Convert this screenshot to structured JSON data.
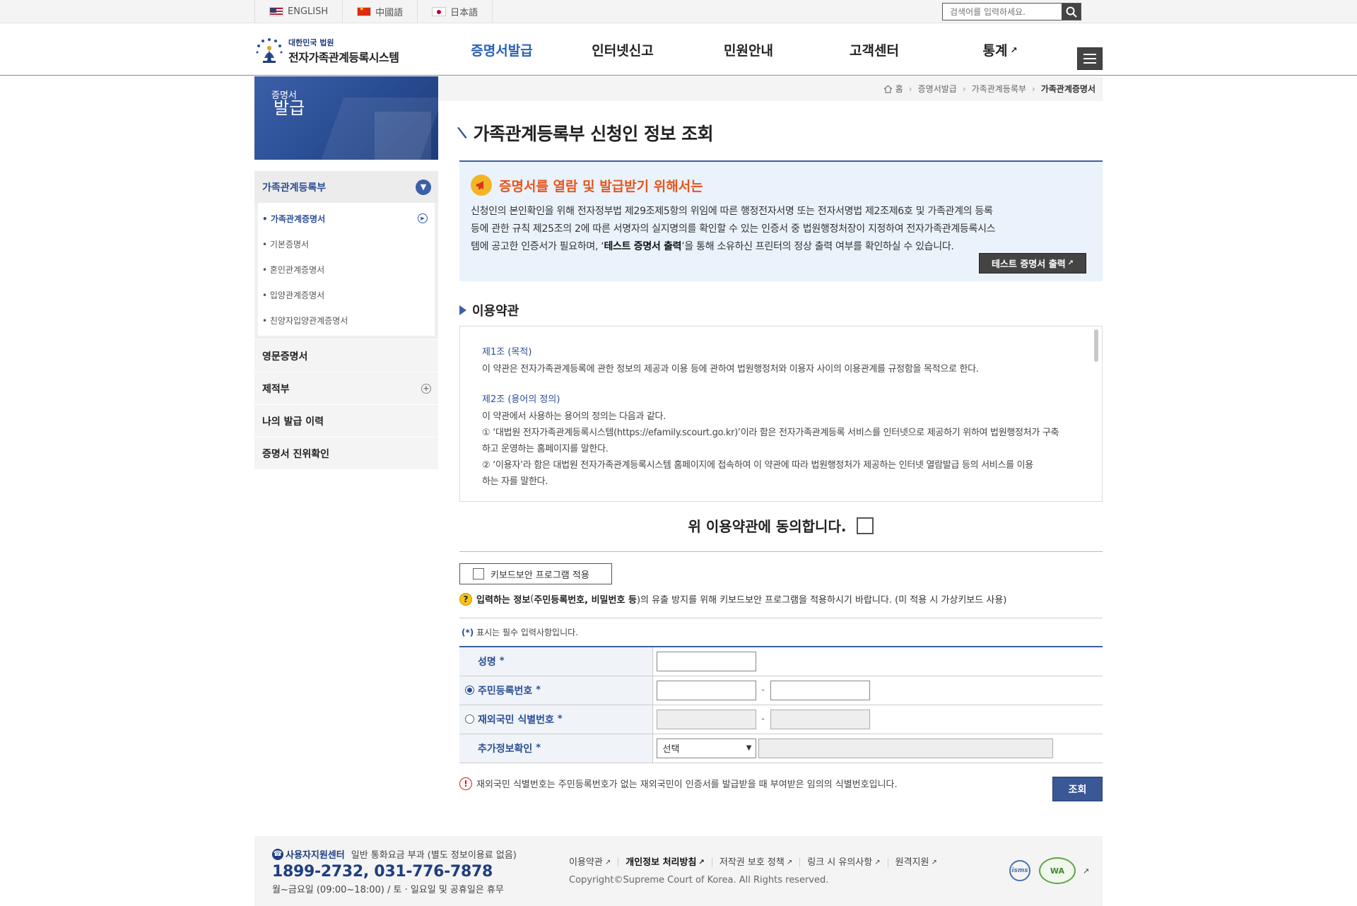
{
  "languages": [
    {
      "label": "ENGLISH",
      "flag": "us-flag-icon"
    },
    {
      "label": "中國語",
      "flag": "china-flag-icon"
    },
    {
      "label": "日本語",
      "flag": "japan-flag-icon"
    }
  ],
  "search": {
    "placeholder": "검색어를 입력하세요."
  },
  "logo": {
    "small": "대한민국 법원",
    "big": "전자가족관계등록시스템"
  },
  "gnb": [
    {
      "label": "증명서발급",
      "active": true
    },
    {
      "label": "인터넷신고"
    },
    {
      "label": "민원안내"
    },
    {
      "label": "고객센터"
    },
    {
      "label": "통계",
      "external": true
    }
  ],
  "sidebar": {
    "banner_small": "증명서",
    "banner_big": "발급",
    "section": "가족관계등록부",
    "sub_items": [
      {
        "label": "• 가족관계증명서",
        "active": true
      },
      {
        "label": "• 기본증명서"
      },
      {
        "label": "• 혼인관계증명서"
      },
      {
        "label": "• 입양관계증명서"
      },
      {
        "label": "• 친양자입양관계증명서"
      }
    ],
    "rows": [
      {
        "label": "영문증명서"
      },
      {
        "label": "제적부",
        "expand": true
      },
      {
        "label": "나의 발급 이력"
      },
      {
        "label": "증명서 진위확인"
      }
    ]
  },
  "breadcrumb": [
    "홈",
    "증명서발급",
    "가족관계등록부",
    "가족관계증명서"
  ],
  "page_title": "가족관계등록부 신청인 정보 조회",
  "notice": {
    "title": "증명서를 열람 및 발급받기 위해서는",
    "body_1": "신청인의 본인확인을 위해 전자정부법 제29조제5항의 위임에 따른 행정전자서명 또는 전자서명법 제2조제6호 및 가족관계의 등록",
    "body_2": "등에 관한 규칙 제25조의 2에 따른 서명자의 실지명의를 확인할 수 있는 인증서 중 법원행정처장이 지정하여 전자가족관계등록시스",
    "body_3a": "템에 공고한 인증서가 필요하며, ‘",
    "body_3b": "테스트 증명서 출력",
    "body_3c": "’을 통해 소유하신 프린터의 정상 출력 여부를 확인하실 수 있습니다.",
    "button": "테스트 증명서 출력"
  },
  "terms": {
    "title": "이용약관",
    "art1_title": "제1조 (목적)",
    "art1_text": "이 약관은 전자가족관계등록에 관한 정보의 제공과 이용 등에 관하여 법원행정처와 이용자 사이의 이용관계를 규정함을 목적으로 한다.",
    "art2_title": "제2조 (용어의 정의)",
    "art2_intro": "이 약관에서 사용하는 용어의 정의는 다음과 같다.",
    "art2_item1a": "① ‘대법원 전자가족관계등록시스템(https://efamily.scourt.go.kr)’이라 함은 전자가족관계등록 서비스를 인터넷으로 제공하기 위하여 법원행정처가 구축",
    "art2_item1b": "하고 운영하는 홈페이지를 말한다.",
    "art2_item2a": "② ‘이용자’라 함은 대법원 전자가족관계등록시스템 홈페이지에 접속하여 이 약관에 따라 법원행정처가 제공하는 인터넷 열람발급 등의 서비스를 이용",
    "art2_item2b": "하는 자를 말한다."
  },
  "agree_label": "위 이용약관에 동의합니다.",
  "keyboard": {
    "button": "키보드보안 프로그램 적용",
    "note_a": "입력하는 정보",
    "note_b": "(",
    "note_c": "주민등록번호, 비밀번호 등",
    "note_d": ")의 유출 방지를 위해 키보드보안 프로그램을 적용하시기 바랍니다. (미 적용 시 가상키보드 사용)"
  },
  "required_note_star": "(*)",
  "required_note": " 표시는 필수 입력사항입니다.",
  "form": {
    "name_label": "성명",
    "rrn_label": "주민등록번호",
    "overseas_label": "재외국민 식별번호",
    "extra_label": "추가정보확인",
    "star": "*",
    "dash": "-",
    "select_value": "선택"
  },
  "warn_note": "재외국민 식별번호는 주민등록번호가 없는 재외국민이 인증서를 발급받을 때 부여받은 임의의 식별번호입니다.",
  "submit": "조회",
  "footer": {
    "center_title": "사용자지원센터",
    "center_note": "일반 통화요금 부과 (별도 정보이용료 없음)",
    "phone": "1899-2732, 031-776-7878",
    "hours": "월~금요일 (09:00~18:00) / 토 · 일요일 및 공휴일은 휴무",
    "links": [
      {
        "label": "이용약관"
      },
      {
        "label": "개인정보 처리방침",
        "bold": true
      },
      {
        "label": "저작권 보호 정책"
      },
      {
        "label": "링크 시 유의사항"
      },
      {
        "label": "원격지원"
      }
    ],
    "copyright": "Copyright©Supreme Court of Korea. All Rights reserved.",
    "badge_isms": "isms",
    "badge_wa": "WA"
  },
  "colors": {
    "brand": "#2c4f96",
    "accent": "#e8561d",
    "notice_bg": "#eaf3fb"
  }
}
